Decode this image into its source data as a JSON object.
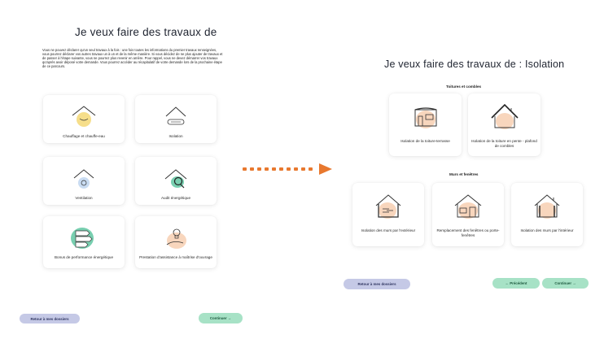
{
  "left": {
    "title": "Je veux faire des travaux de",
    "intro": "Vous ne pouvez déclarer qu'un seul travaux à la fois : une fois toutes les informations du premier travaux renseignées, vous pourrez déclarer vos autres travaux un à un et de la même manière. Si vous décidez de ne plus ajouter de travaux et de passer à l'étape suivante, vous ne pourrez plus revenir en arrière. Pour rappel, vous ne devez démarrer vos travaux qu'après avoir déposé votre demande. Vous pourrez accéder au récapitulatif de votre demande lors de la prochaine étape de ce parcours.",
    "cards": [
      {
        "label": "Chauffage et chauffe-eau"
      },
      {
        "label": "Isolation"
      },
      {
        "label": "Ventilation"
      },
      {
        "label": "Audit énergétique"
      },
      {
        "label": "Bonus de performance énergétique"
      },
      {
        "label": "Prestation d'assistance à maîtrise d'ouvrage"
      }
    ],
    "back_label": "Retour à mes dossiers",
    "continue_label": "Continuer →"
  },
  "right": {
    "title": "Je veux faire des travaux de : Isolation",
    "sections": [
      {
        "label": "Toitures et combles"
      },
      {
        "label": "Murs et fenêtres"
      }
    ],
    "cards": [
      {
        "label": "Isolation de la toiture-terrasse"
      },
      {
        "label": "Isolation de la toiture en pente - plafond de combles"
      },
      {
        "label": "Isolation des murs par l'extérieur"
      },
      {
        "label": "Remplacement des fenêtres ou porte-fenêtres"
      },
      {
        "label": "Isolation des murs par l'intérieur"
      }
    ],
    "back_label": "Retour à mes dossiers",
    "previous_label": "← Précédent",
    "continue_label": "Continuer →"
  },
  "colors": {
    "accent_orange": "#e8782e",
    "back_button": "#c5c9e6",
    "green_button": "#a7e2c6",
    "blob_yellow": "#f6de8a",
    "blob_blue": "#c9dcf2",
    "blob_teal": "#78cfb0",
    "blob_peach": "#f8d6bd"
  }
}
